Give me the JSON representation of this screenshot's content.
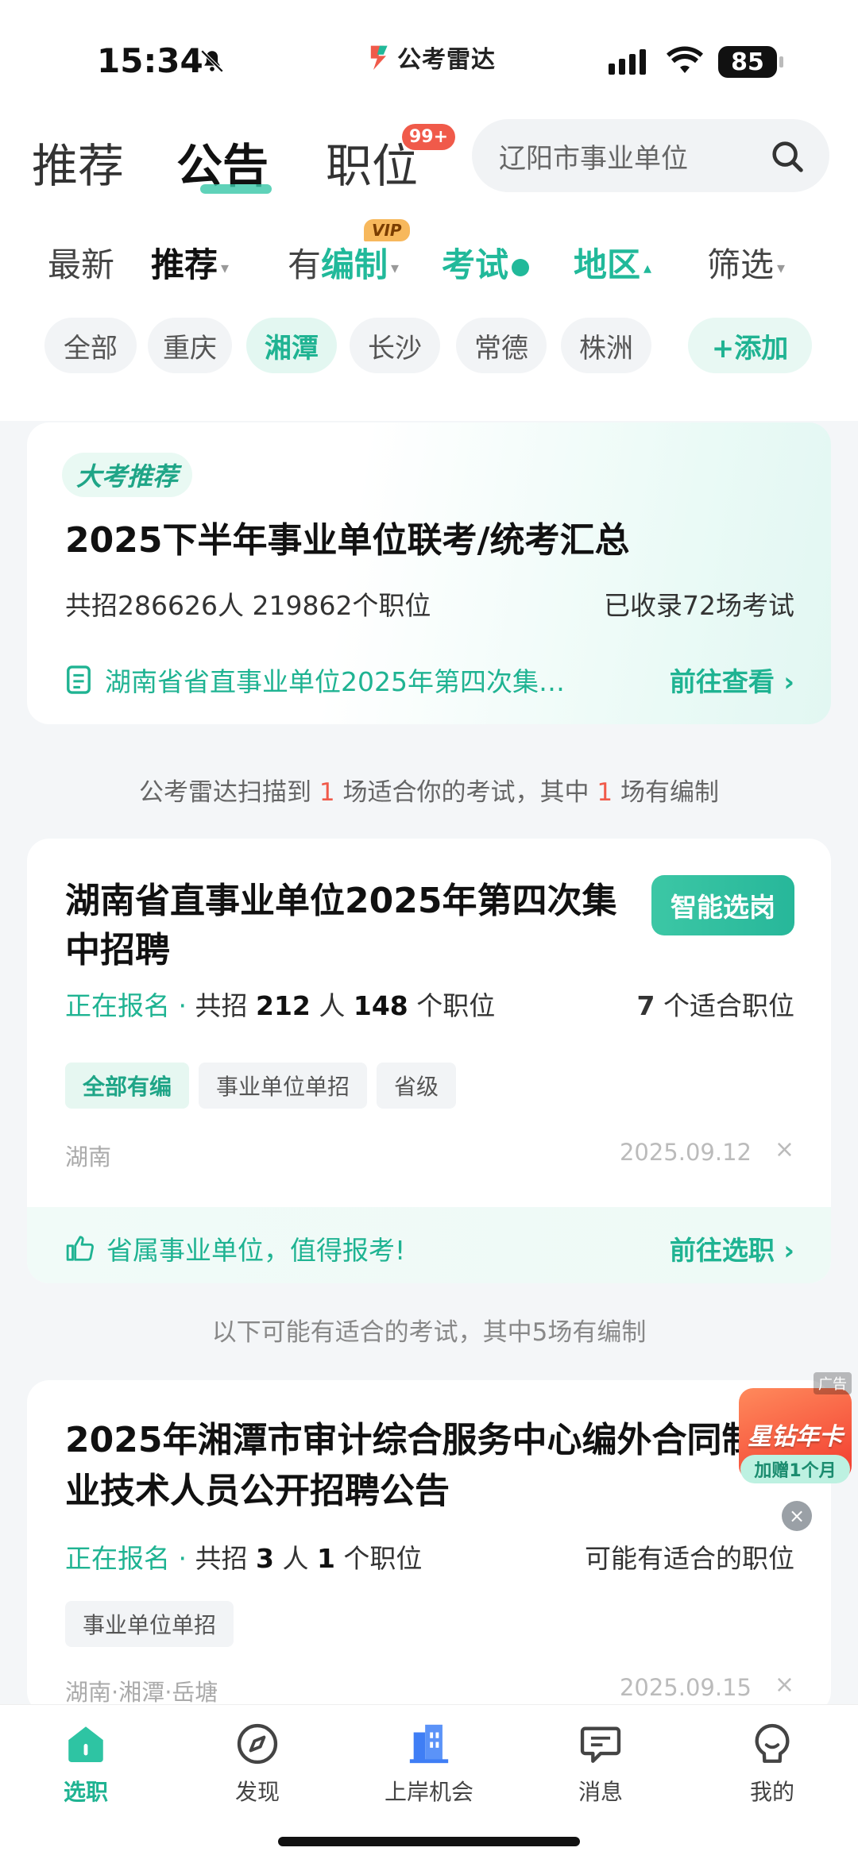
{
  "status": {
    "time": "15:34",
    "battery": "85",
    "brand": "公考雷达"
  },
  "header": {
    "tabs": [
      "推荐",
      "公告",
      "职位"
    ],
    "badge": "99+",
    "search_placeholder": "辽阳市事业单位"
  },
  "subtabs": {
    "latest": "最新",
    "recommend": "推荐",
    "bianzhi_prefix": "有",
    "bianzhi": "编制",
    "vip": "VIP",
    "exam": "考试",
    "region": "地区",
    "filter": "筛选"
  },
  "chips": [
    "全部",
    "重庆",
    "湘潭",
    "长沙",
    "常德",
    "株洲"
  ],
  "chip_add": "+添加",
  "featured": {
    "badge": "大考推荐",
    "title": "2025下半年事业单位联考/统考汇总",
    "stats": "共招286626人 219862个职位",
    "count": "已收录72场考试",
    "link_text": "湖南省省直事业单位2025年第四次集…",
    "link_go": "前往查看 ›"
  },
  "scan_note": {
    "p1": "公考雷达扫描到 ",
    "n1": "1",
    "p2": " 场适合你的考试，其中 ",
    "n2": "1",
    "p3": " 场有编制"
  },
  "card1": {
    "title": "湖南省直事业单位2025年第四次集中招聘",
    "button": "智能选岗",
    "status": "正在报名",
    "dot": " · ",
    "recruit_prefix": "共招 ",
    "recruit_num": "212",
    "recruit_unit": " 人  ",
    "positions_num": "148",
    "positions_unit": " 个职位",
    "fit_num": "7",
    "fit_text": " 个适合职位",
    "tags": [
      "全部有编",
      "事业单位单招",
      "省级"
    ],
    "location": "湖南",
    "date": "2025.09.12",
    "close": "×",
    "footer_text": "省属事业单位，值得报考!",
    "footer_go": "前往选职 ›"
  },
  "more_note": "以下可能有适合的考试，其中5场有编制",
  "card2": {
    "title": "2025年湘潭市审计综合服务中心编外合同制专业技术人员公开招聘公告",
    "status": "正在报名",
    "dot": " · ",
    "recruit_prefix": "共招 ",
    "recruit_num": "3",
    "recruit_unit": " 人  ",
    "positions_num": "1",
    "positions_unit": " 个职位",
    "fit_text": "可能有适合的职位",
    "tags": [
      "事业单位单招"
    ],
    "location": "湖南·湘潭·岳塘",
    "date": "2025.09.15",
    "close": "×"
  },
  "ad": {
    "badge": "广告",
    "title": "星钻年卡",
    "sub": "加赠1个月",
    "close": "×"
  },
  "bottom_nav": [
    "选职",
    "发现",
    "上岸机会",
    "消息",
    "我的"
  ],
  "colors": {
    "accent": "#1fb392",
    "red": "#f05a4a"
  }
}
